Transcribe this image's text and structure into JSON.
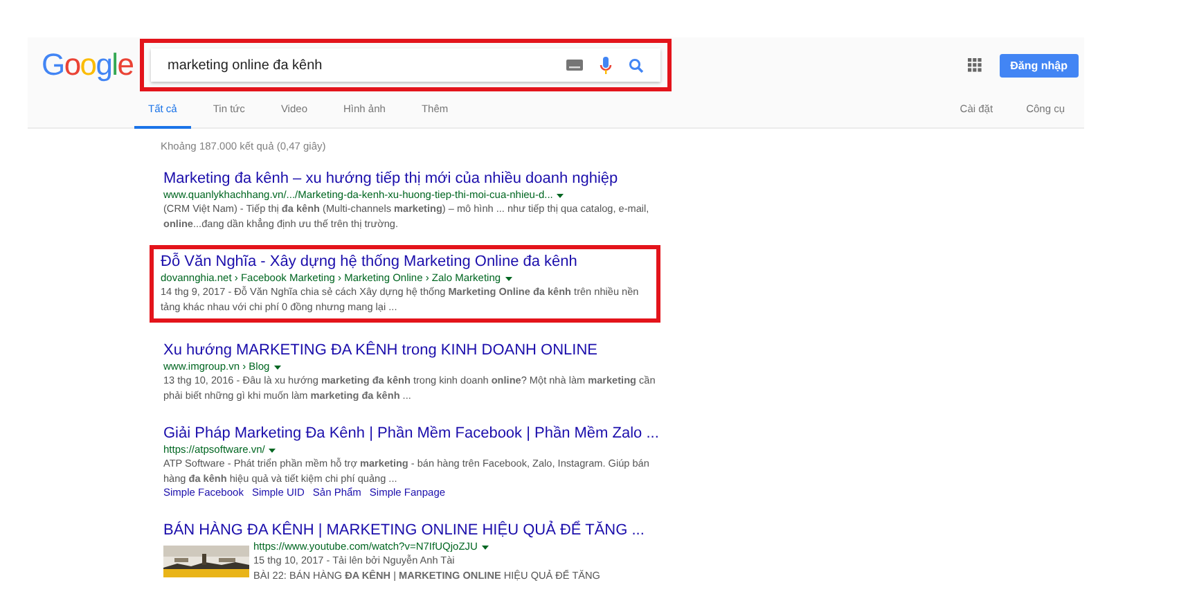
{
  "logo": [
    {
      "letter": "G",
      "color": "#4285f4"
    },
    {
      "letter": "o",
      "color": "#ea4335"
    },
    {
      "letter": "o",
      "color": "#fbbc05"
    },
    {
      "letter": "g",
      "color": "#4285f4"
    },
    {
      "letter": "l",
      "color": "#34a853"
    },
    {
      "letter": "e",
      "color": "#ea4335"
    }
  ],
  "search": {
    "value": "marketing online đa kênh",
    "highlighted": true
  },
  "signin_button": "Đăng nhập",
  "tabs": [
    {
      "label": "Tất cả",
      "selected": true
    },
    {
      "label": "Tin tức",
      "selected": false
    },
    {
      "label": "Video",
      "selected": false
    },
    {
      "label": "Hình ảnh",
      "selected": false
    },
    {
      "label": "Thêm",
      "selected": false
    }
  ],
  "tools": [
    "Cài đặt",
    "Công cụ"
  ],
  "result_stats": "Khoảng 187.000 kết quả (0,47 giây)",
  "results": [
    {
      "title": "Marketing đa kênh – xu hướng tiếp thị mới của nhiều doanh nghiệp",
      "url": "www.quanlykhachhang.vn/.../Marketing-da-kenh-xu-huong-tiep-thi-moi-cua-nhieu-d...",
      "snippet": "(CRM Việt Nam) - Tiếp thị **đa kênh** (Multi-channels **marketing**) – mô hình ... như tiếp thị qua catalog, e-mail, **online**...đang dần khẳng định ưu thế trên thị trường.",
      "highlighted": false
    },
    {
      "title": "Đỗ Văn Nghĩa - Xây dựng hệ thống Marketing Online đa kênh",
      "url": "dovannghia.net › Facebook Marketing › Marketing Online › Zalo Marketing",
      "snippet": "14 thg 9, 2017 - Đỗ Văn Nghĩa chia sẻ cách Xây dựng hệ thống **Marketing Online đa kênh** trên nhiều nền tảng khác nhau với chi phí 0 đồng nhưng mang lại ...",
      "highlighted": true
    },
    {
      "title": "Xu hướng MARKETING ĐA KÊNH trong KINH DOANH ONLINE",
      "url": "www.imgroup.vn › Blog",
      "snippet": "13 thg 10, 2016 - Đâu là xu hướng **marketing đa kênh** trong kinh doanh **online**? Một nhà làm **marketing** cần phải biết những gì khi muốn làm **marketing đa kênh** ...",
      "highlighted": false
    },
    {
      "title": "Giải Pháp Marketing Đa Kênh | Phần Mềm Facebook | Phần Mềm Zalo ...",
      "url": "https://atpsoftware.vn/",
      "snippet": "ATP Software - Phát triển phần mềm hỗ trợ **marketing** - bán hàng trên Facebook, Zalo, Instagram. Giúp bán hàng **đa kênh** hiệu quả và tiết kiệm chi phí quảng ...",
      "sitelinks": [
        "Simple Facebook",
        "Simple UID",
        "Sản Phẩm",
        "Simple Fanpage"
      ],
      "highlighted": false
    },
    {
      "title": "BÁN HÀNG ĐA KÊNH | MARKETING ONLINE HIỆU QUẢ ĐỂ TĂNG ...",
      "url": "https://www.youtube.com/watch?v=N7IfUQjoZJU",
      "date": "15 thg 10, 2017 - Tải lên bởi Nguyễn Anh Tài",
      "snippet": "BÀI 22: BÁN HÀNG **ĐA KÊNH** | **MARKETING ONLINE** HIỆU QUẢ ĐỂ TĂNG",
      "highlighted": false
    }
  ]
}
